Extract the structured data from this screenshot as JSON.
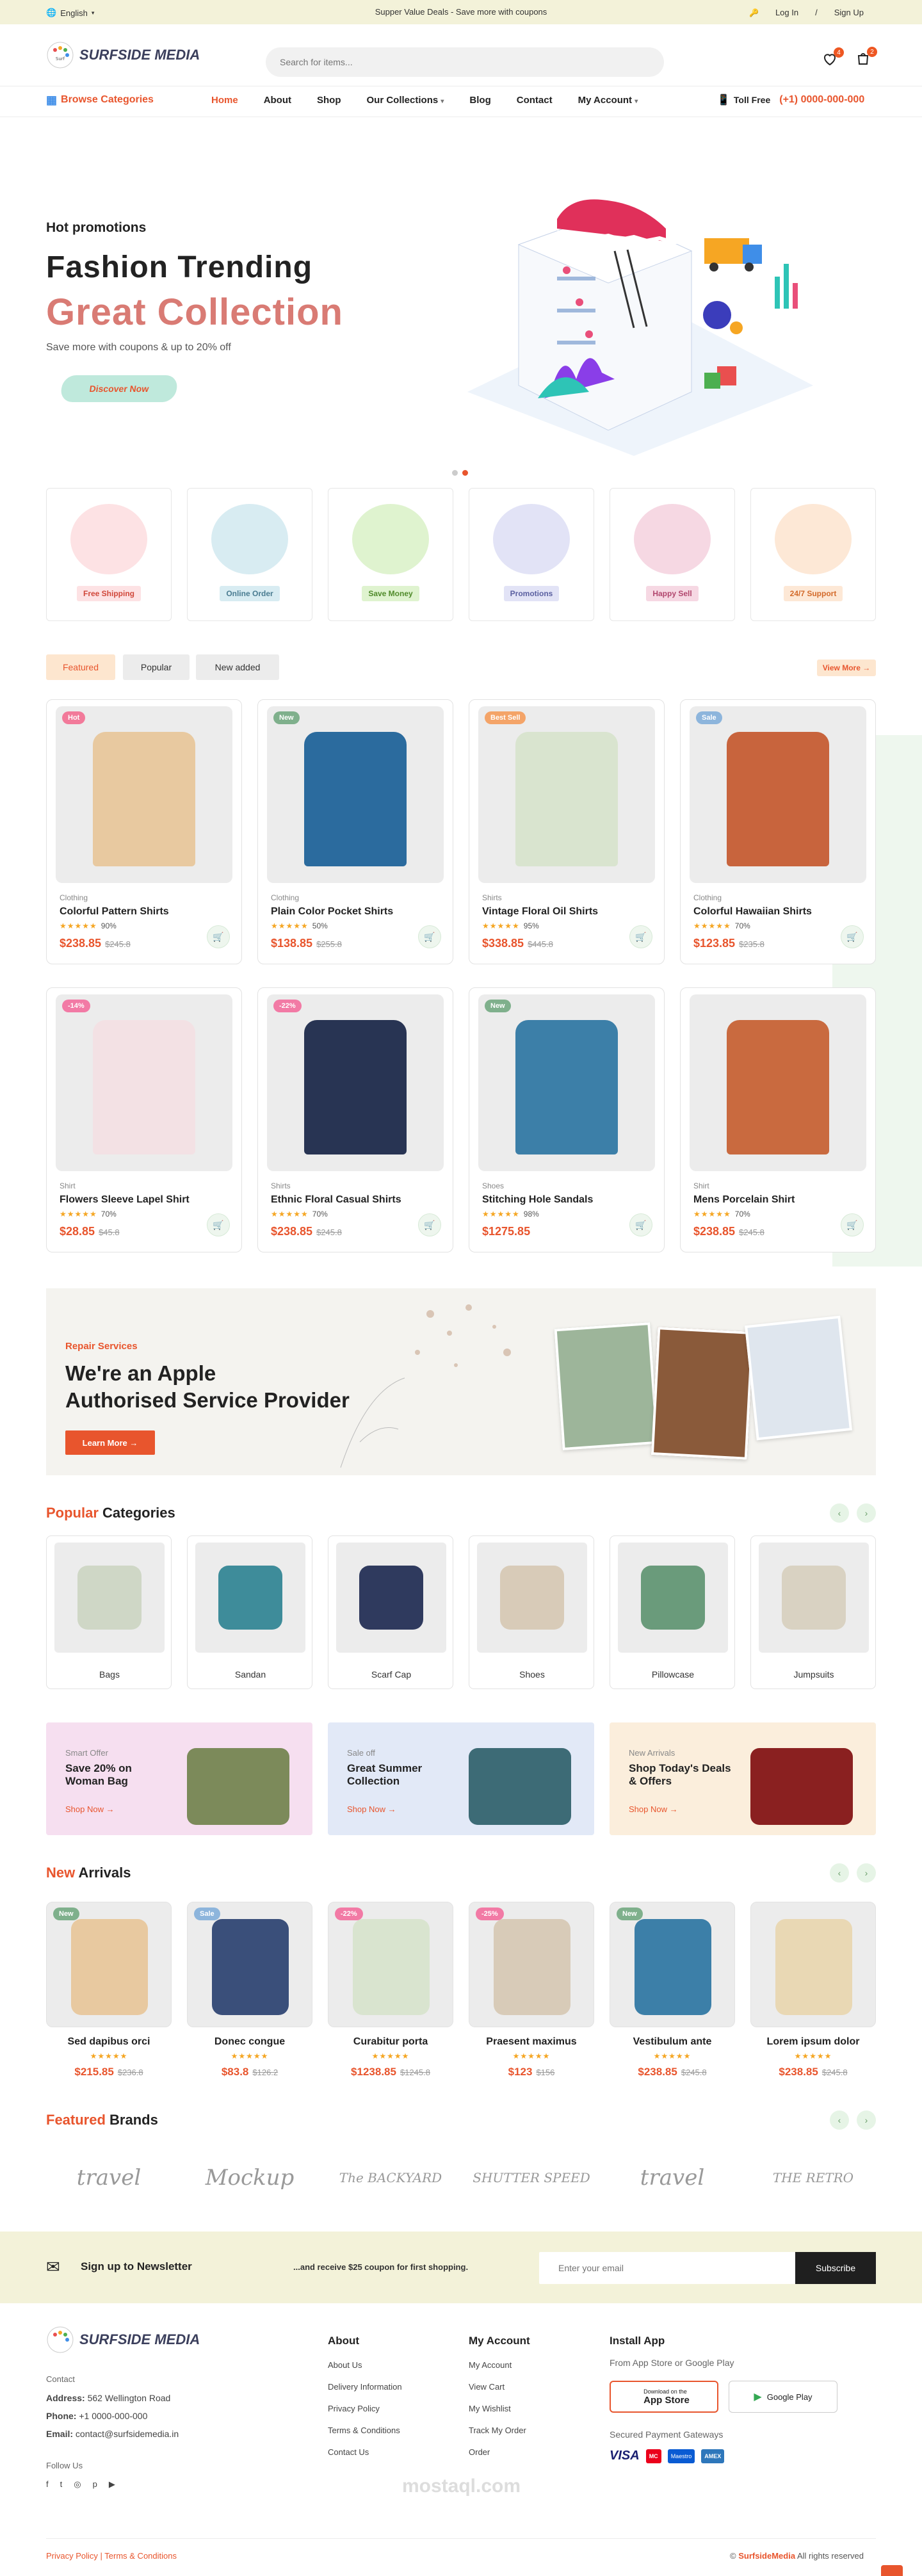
{
  "topbar": {
    "language": "English",
    "promo": "Supper Value Deals - Save more with coupons",
    "login": "Log In",
    "signup": "Sign Up"
  },
  "header": {
    "logo": "SURFSIDE MEDIA",
    "search_placeholder": "Search for items...",
    "wishlist_count": "4",
    "cart_count": "2"
  },
  "nav": {
    "browse": "Browse Categories",
    "items": [
      "Home",
      "About",
      "Shop",
      "Our Collections",
      "Blog",
      "Contact",
      "My Account"
    ],
    "toll_label": "Toll Free",
    "toll_number": "(+1) 0000-000-000"
  },
  "hero": {
    "kicker": "Hot promotions",
    "title": "Fashion Trending",
    "subtitle": "Great Collection",
    "desc": "Save more with coupons & up to 20% off",
    "button": "Discover Now"
  },
  "features": [
    {
      "label": "Free Shipping",
      "color": "#fde2e4",
      "text": "#d0473a"
    },
    {
      "label": "Online Order",
      "color": "#d8ecf2",
      "text": "#4a7c91"
    },
    {
      "label": "Save Money",
      "color": "#dff3cf",
      "text": "#4f8a2a"
    },
    {
      "label": "Promotions",
      "color": "#e2e3f6",
      "text": "#5a5fa0"
    },
    {
      "label": "Happy Sell",
      "color": "#f6d8e3",
      "text": "#b2476e"
    },
    {
      "label": "24/7 Support",
      "color": "#fde8d6",
      "text": "#d36a2a"
    }
  ],
  "tabs": {
    "featured": "Featured",
    "popular": "Popular",
    "new_added": "New added",
    "view_more": "View More →"
  },
  "products": [
    {
      "tag": "Hot",
      "tagc": "#f27a9a",
      "cat": "Clothing",
      "name": "Colorful Pattern Shirts",
      "rate": "90%",
      "price": "$238.85",
      "old": "$245.8"
    },
    {
      "tag": "New",
      "tagc": "#7fb08c",
      "cat": "Clothing",
      "name": "Plain Color Pocket Shirts",
      "rate": "50%",
      "price": "$138.85",
      "old": "$255.8"
    },
    {
      "tag": "Best Sell",
      "tagc": "#f4a468",
      "cat": "Shirts",
      "name": "Vintage Floral Oil Shirts",
      "rate": "95%",
      "price": "$338.85",
      "old": "$445.8"
    },
    {
      "tag": "Sale",
      "tagc": "#8db5dc",
      "cat": "Clothing",
      "name": "Colorful Hawaiian Shirts",
      "rate": "70%",
      "price": "$123.85",
      "old": "$235.8"
    },
    {
      "tag": "-14%",
      "tagc": "#f27aa5",
      "cat": "Shirt",
      "name": "Flowers Sleeve Lapel Shirt",
      "rate": "70%",
      "price": "$28.85",
      "old": "$45.8"
    },
    {
      "tag": "-22%",
      "tagc": "#f27aa5",
      "cat": "Shirts",
      "name": "Ethnic Floral Casual Shirts",
      "rate": "70%",
      "price": "$238.85",
      "old": "$245.8"
    },
    {
      "tag": "New",
      "tagc": "#7fb08c",
      "cat": "Shoes",
      "name": "Stitching Hole Sandals",
      "rate": "98%",
      "price": "$1275.85",
      "old": ""
    },
    {
      "tag": "",
      "tagc": "#fff",
      "cat": "Shirt",
      "name": "Mens Porcelain Shirt",
      "rate": "70%",
      "price": "$238.85",
      "old": "$245.8"
    }
  ],
  "service_banner": {
    "kicker": "Repair Services",
    "line1": "We're an Apple",
    "line2": "Authorised Service Provider",
    "button": "Learn More →"
  },
  "popular": {
    "hl": "Popular",
    "rest": " Categories",
    "items": [
      "Bags",
      "Sandan",
      "Scarf Cap",
      "Shoes",
      "Pillowcase",
      "Jumpsuits"
    ]
  },
  "promos": [
    {
      "kicker": "Smart Offer",
      "title": "Save 20% on Woman Bag",
      "link": "Shop Now →",
      "bg": "#f6dff0"
    },
    {
      "kicker": "Sale off",
      "title": "Great Summer Collection",
      "link": "Shop Now →",
      "bg": "#e2e9f7"
    },
    {
      "kicker": "New Arrivals",
      "title": "Shop Today's Deals & Offers",
      "link": "Shop Now →",
      "bg": "#fbeedc"
    }
  ],
  "arrivals": {
    "hl": "New",
    "rest": " Arrivals",
    "items": [
      {
        "tag": "New",
        "tagc": "#7fb08c",
        "name": "Sed dapibus orci",
        "price": "$215.85",
        "old": "$236.8"
      },
      {
        "tag": "Sale",
        "tagc": "#8db5dc",
        "name": "Donec congue",
        "price": "$83.8",
        "old": "$126.2"
      },
      {
        "tag": "-22%",
        "tagc": "#f27aa5",
        "name": "Curabitur porta",
        "price": "$1238.85",
        "old": "$1245.8"
      },
      {
        "tag": "-25%",
        "tagc": "#f27aa5",
        "name": "Praesent maximus",
        "price": "$123",
        "old": "$156"
      },
      {
        "tag": "New",
        "tagc": "#7fb08c",
        "name": "Vestibulum ante",
        "price": "$238.85",
        "old": "$245.8"
      },
      {
        "tag": "",
        "tagc": "#fff",
        "name": "Lorem ipsum dolor",
        "price": "$238.85",
        "old": "$245.8"
      }
    ]
  },
  "brands": {
    "hl": "Featured",
    "rest": " Brands",
    "items": [
      "travel",
      "Mockup",
      "The BACKYARD",
      "SHUTTER SPEED",
      "travel",
      "THE RETRO"
    ]
  },
  "newsletter": {
    "title": "Sign up to Newsletter",
    "desc": "...and receive $25 coupon for first shopping.",
    "placeholder": "Enter your email",
    "button": "Subscribe"
  },
  "footer": {
    "contact_title": "Contact",
    "address_label": "Address:",
    "address": "562 Wellington Road",
    "phone_label": "Phone:",
    "phone": "+1 0000-000-000",
    "email_label": "Email:",
    "email": "contact@surfsidemedia.in",
    "follow": "Follow Us",
    "about_title": "About",
    "about": [
      "About Us",
      "Delivery Information",
      "Privacy Policy",
      "Terms & Conditions",
      "Contact Us"
    ],
    "account_title": "My Account",
    "account": [
      "My Account",
      "View Cart",
      "My Wishlist",
      "Track My Order",
      "Order"
    ],
    "app_title": "Install App",
    "app_sub": "From App Store or Google Play",
    "appstore_small": "Download on the",
    "appstore": "App Store",
    "googleplay": "Google Play",
    "payment": "Secured Payment Gateways",
    "cards": [
      "VISA",
      "MC",
      "Maestro",
      "AMEX"
    ],
    "bottom_left": "Privacy Policy | Terms & Conditions",
    "bottom_right_prefix": "© ",
    "bottom_right_brand": "SurfsideMedia",
    "bottom_right_suffix": " All rights reserved",
    "watermark": "mostaql.com"
  }
}
